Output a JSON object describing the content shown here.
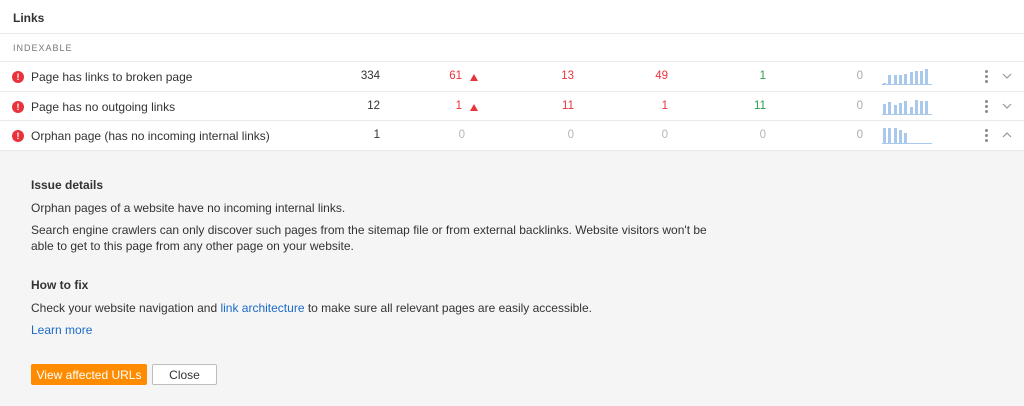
{
  "section": {
    "title": "Links",
    "group_label": "INDEXABLE"
  },
  "rows": [
    {
      "icon": "!",
      "name": "Page has links to broken page",
      "total": "334",
      "new": "61",
      "new_trend": "up",
      "c3": "13",
      "c4": "49",
      "c5": "1",
      "c6": "0",
      "spark": [
        0.15,
        0.6,
        0.6,
        0.65,
        0.7,
        0.8,
        0.85,
        0.85,
        1.0
      ],
      "expanded": false
    },
    {
      "icon": "!",
      "name": "Page has no outgoing links",
      "total": "12",
      "new": "1",
      "new_trend": "up",
      "c3": "11",
      "c4": "1",
      "c5": "11",
      "c6": "0",
      "spark": [
        0.7,
        0.8,
        0.6,
        0.75,
        0.9,
        0.5,
        0.95,
        0.85,
        0.9
      ],
      "expanded": false
    },
    {
      "icon": "!",
      "name": "Orphan page (has no incoming internal links)",
      "total": "1",
      "new": "0",
      "c3": "0",
      "c4": "0",
      "c5": "0",
      "c6": "0",
      "spark": [
        1.0,
        1.0,
        1.0,
        0.85,
        0.7,
        0.0,
        0.0,
        0.0,
        0.0
      ],
      "expanded": true
    }
  ],
  "details": {
    "issue_heading": "Issue details",
    "issue_p1": "Orphan pages of a website have no incoming internal links.",
    "issue_p2": "Search engine crawlers can only discover such pages from the sitemap file or from external backlinks. Website visitors won't be able to get to this page from any other page on your website.",
    "fix_heading": "How to fix",
    "fix_before": "Check your website navigation and ",
    "fix_link": "link architecture",
    "fix_after": " to make sure all relevant pages are easily accessible.",
    "learn_more": "Learn more",
    "view_button": "View affected URLs",
    "close_button": "Close"
  },
  "colors": {
    "accent": "#ff8c00",
    "error": "#e8333c",
    "positive": "#2a9b4d",
    "link": "#1b6ac9",
    "spark": "#a9c9ec"
  }
}
